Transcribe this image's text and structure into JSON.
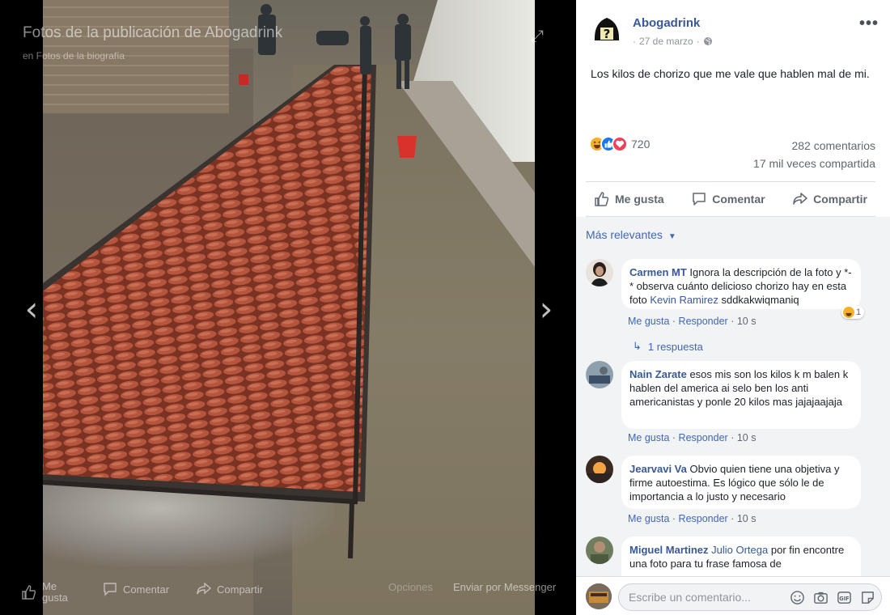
{
  "viewer": {
    "title": "Fotos de la publicación de Abogadrink",
    "subtitle": "en Fotos de la biografía",
    "actions": {
      "like": "Me gusta",
      "comment": "Comentar",
      "share": "Compartir",
      "options": "Opciones",
      "messenger": "Enviar por Messenger"
    }
  },
  "post": {
    "page_name": "Abogadrink",
    "date": "27 de marzo",
    "text": "Los kilos de chorizo que me vale que hablen mal de mi.",
    "reactions_count": "720",
    "comments_count": "282 comentarios",
    "shares_count": "17 mil veces compartida",
    "actions": {
      "like": "Me gusta",
      "comment": "Comentar",
      "share": "Compartir"
    }
  },
  "comments_section": {
    "sort_label": "Más relevantes",
    "items": [
      {
        "author": "Carmen MT",
        "text": "Ignora la descripción de la foto y *-* observa cuánto delicioso chorizo hay en esta foto",
        "mention": "Kevin Ramirez",
        "text_after": "sddkakwiqmaniq",
        "like": "Me gusta",
        "reply": "Responder",
        "time": "10 s",
        "reaction_count": "1"
      },
      {
        "author": "Nain Zarate",
        "text": "esos mis son los kilos k m balen k hablen del america ai selo ben los anti americanistas y ponle 20 kilos mas jajajaajaja",
        "like": "Me gusta",
        "reply": "Responder",
        "time": "10 s"
      },
      {
        "author": "Jearvavi Va",
        "text": "Obvio quien tiene una objetiva y firme autoestima. Es lógico que sólo le de importancia a lo justo y necesario",
        "like": "Me gusta",
        "reply": "Responder",
        "time": "10 s"
      },
      {
        "author": "Miguel Martinez",
        "mention": "Julio Ortega",
        "text": "por fin encontre una foto para tu frase famosa de"
      }
    ],
    "replies_label": "1 respuesta"
  },
  "composer": {
    "placeholder": "Escribe un comentario..."
  },
  "colors": {
    "link": "#385898",
    "accent": "#4267b2",
    "panel_bg": "#f2f3f5"
  }
}
